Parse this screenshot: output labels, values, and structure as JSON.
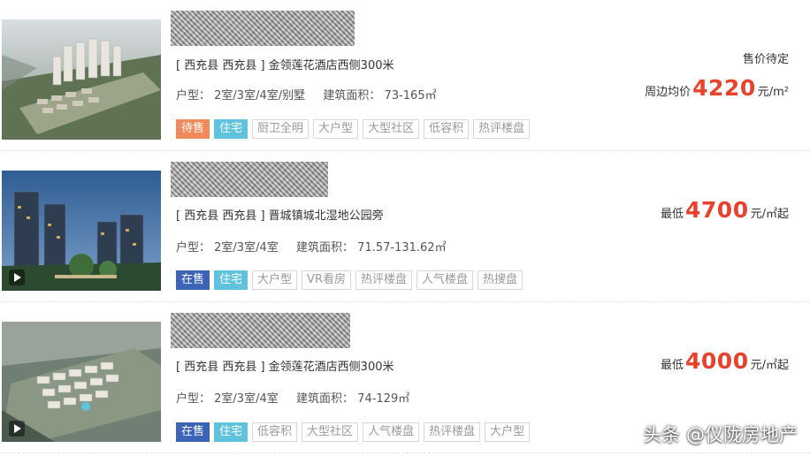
{
  "colors": {
    "price_accent": "#e8412c",
    "tag_dai_shou": "#f08a5d",
    "tag_zhu_zhai": "#5fc3dd",
    "tag_zai_shou": "#3b63b6"
  },
  "listings": [
    {
      "address": "[ 西充县 西充县 ] 金领莲花酒店西侧300米",
      "layout_label": "户型：",
      "layout_value": "2室/3室/4室/别墅",
      "area_label": "建筑面积：",
      "area_value": "73-165㎡",
      "status_text": "售价待定",
      "price_label": "周边均价",
      "price_value": "4220",
      "price_unit": "元/m²",
      "tags": [
        {
          "text": "待售",
          "icon": "",
          "color": "#f08a5d"
        },
        {
          "text": "住宅",
          "color": "#5fc3dd"
        },
        {
          "text": "厨卫全明"
        },
        {
          "text": "大户型"
        },
        {
          "text": "大型社区"
        },
        {
          "text": "低容积"
        },
        {
          "text": "热评楼盘"
        }
      ]
    },
    {
      "address": "[ 西充县 西充县 ] 晋城镇城北湿地公园旁",
      "layout_label": "户型：",
      "layout_value": "2室/3室/4室",
      "area_label": "建筑面积：",
      "area_value": "71.57-131.62㎡",
      "price_label": "最低",
      "price_value": "4700",
      "price_unit": "元/㎡起",
      "tags": [
        {
          "text": "在售",
          "color": "#3b63b6"
        },
        {
          "text": "住宅",
          "color": "#5fc3dd"
        },
        {
          "text": "大户型"
        },
        {
          "text": "VR看房"
        },
        {
          "text": "热评楼盘"
        },
        {
          "text": "人气楼盘"
        },
        {
          "text": "热搜盘"
        }
      ]
    },
    {
      "address": "[ 西充县 西充县 ] 金领莲花酒店西侧300米",
      "layout_label": "户型：",
      "layout_value": "2室/3室/4室",
      "area_label": "建筑面积：",
      "area_value": "74-129㎡",
      "price_label": "最低",
      "price_value": "4000",
      "price_unit": "元/㎡起",
      "tags": [
        {
          "text": "在售",
          "color": "#3b63b6"
        },
        {
          "text": "住宅",
          "color": "#5fc3dd"
        },
        {
          "text": "低容积"
        },
        {
          "text": "大型社区"
        },
        {
          "text": "人气楼盘"
        },
        {
          "text": "热评楼盘"
        },
        {
          "text": "大户型"
        }
      ]
    }
  ],
  "watermark": "头条 @仪陇房地产",
  "icons": {
    "vr_play": "play-icon"
  }
}
